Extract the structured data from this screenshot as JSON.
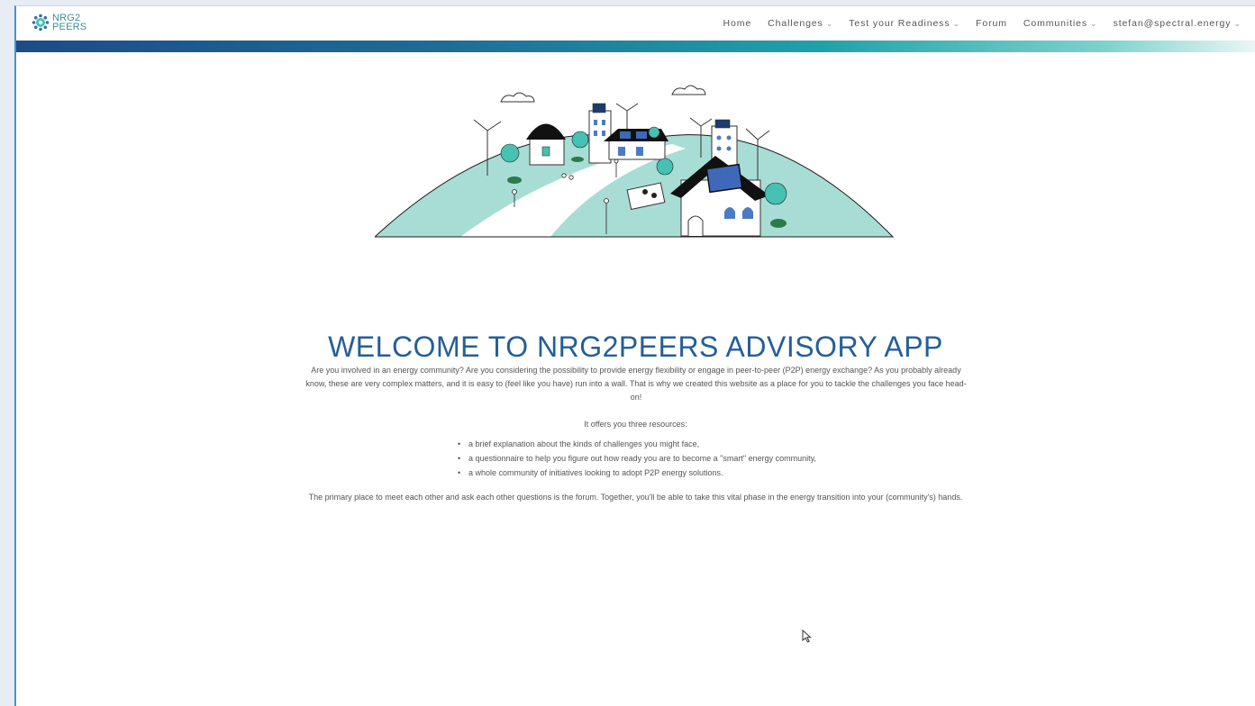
{
  "header": {
    "logo": {
      "line1": "NRG2",
      "line2": "PEERS"
    },
    "nav": [
      {
        "label": "Home",
        "has_dropdown": false
      },
      {
        "label": "Challenges",
        "has_dropdown": true
      },
      {
        "label": "Test your Readiness",
        "has_dropdown": true
      },
      {
        "label": "Forum",
        "has_dropdown": false
      },
      {
        "label": "Communities",
        "has_dropdown": true
      },
      {
        "label": "stefan@spectral.energy",
        "has_dropdown": true
      }
    ],
    "chevron": "⌄"
  },
  "colors": {
    "title": "#235f99",
    "teal": "#46c1b3",
    "hill": "#a8ddd5",
    "gradient_start": "#1c4c86",
    "gradient_end": "#7fd2cc"
  },
  "main": {
    "title": "WELCOME TO NRG2PEERS ADVISORY APP",
    "intro": "Are you involved in an energy community? Are you considering the possibility to provide energy flexibility or engage in peer-to-peer (P2P) energy exchange? As you probably already know, these are very complex matters, and it is easy to (feel like you have) run into a wall. That is why we created this website as a place for you to tackle the challenges you face head-on!",
    "offers_heading": "It offers you three resources:",
    "resources": [
      "a brief explanation about the kinds of challenges you might face,",
      "a questionnaire to help you figure out how ready you are to become a \"smart\" energy community,",
      "a whole community of initiatives looking to adopt P2P energy solutions."
    ],
    "closing": "The primary place to meet each other and ask each other questions is the forum. Together, you'll be able to take this vital phase in the energy transition into your (community's) hands."
  }
}
